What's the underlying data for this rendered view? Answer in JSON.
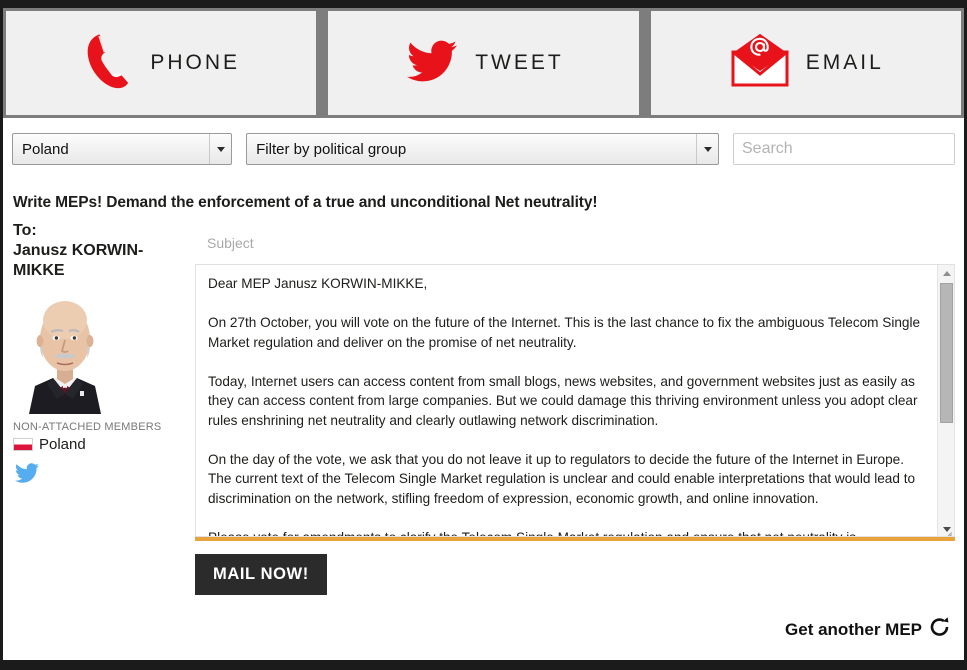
{
  "tabs": [
    {
      "label": "PHONE",
      "icon": "phone-icon",
      "color": "#e8131a"
    },
    {
      "label": "TWEET",
      "icon": "twitter-bird-icon",
      "color": "#e8131a"
    },
    {
      "label": "EMAIL",
      "icon": "email-envelope-icon",
      "color": "#e8131a"
    }
  ],
  "filters": {
    "country_value": "Poland",
    "group_value": "Filter by political group",
    "search_placeholder": "Search",
    "search_value": ""
  },
  "headline": "Write MEPs! Demand the enforcement of a true and unconditional Net neutrality!",
  "mep": {
    "to_label": "To:",
    "name": "Janusz KORWIN-MIKKE",
    "political_group": "NON-ATTACHED MEMBERS",
    "country": "Poland",
    "flag": "poland-flag-icon",
    "twitter": "twitter-bird-icon"
  },
  "compose": {
    "subject_placeholder": "Subject",
    "subject_value": "",
    "body": "Dear MEP Janusz KORWIN-MIKKE,\n\nOn 27th October, you will vote on the future of the Internet. This is the last chance to fix the ambiguous Telecom Single Market regulation and deliver on the promise of net neutrality.\n\nToday, Internet users can access content from small blogs, news websites, and government websites just as easily as they can access content from large companies. But we could damage this thriving environment unless you adopt clear rules enshrining net neutrality and clearly outlawing network discrimination.\n\nOn the day of the vote, we ask that you do not leave it up to regulators to decide the future of the Internet in Europe. The current text of the Telecom Single Market regulation is unclear and could enable interpretations that would lead to discrimination on the network, stifling freedom of expression, economic growth, and online innovation.\n\nPlease vote for amendments to clarify the Telecom Single Market regulation and ensure that net neutrality is"
  },
  "actions": {
    "mail_now": "MAIL NOW!",
    "get_another_mep": "Get another MEP",
    "refresh_icon": "refresh-icon"
  },
  "colors": {
    "accent_red": "#e8131a",
    "orange_bar": "#e8a33d",
    "button_dark": "#2b2b2b",
    "twitter_blue": "#55acee"
  }
}
